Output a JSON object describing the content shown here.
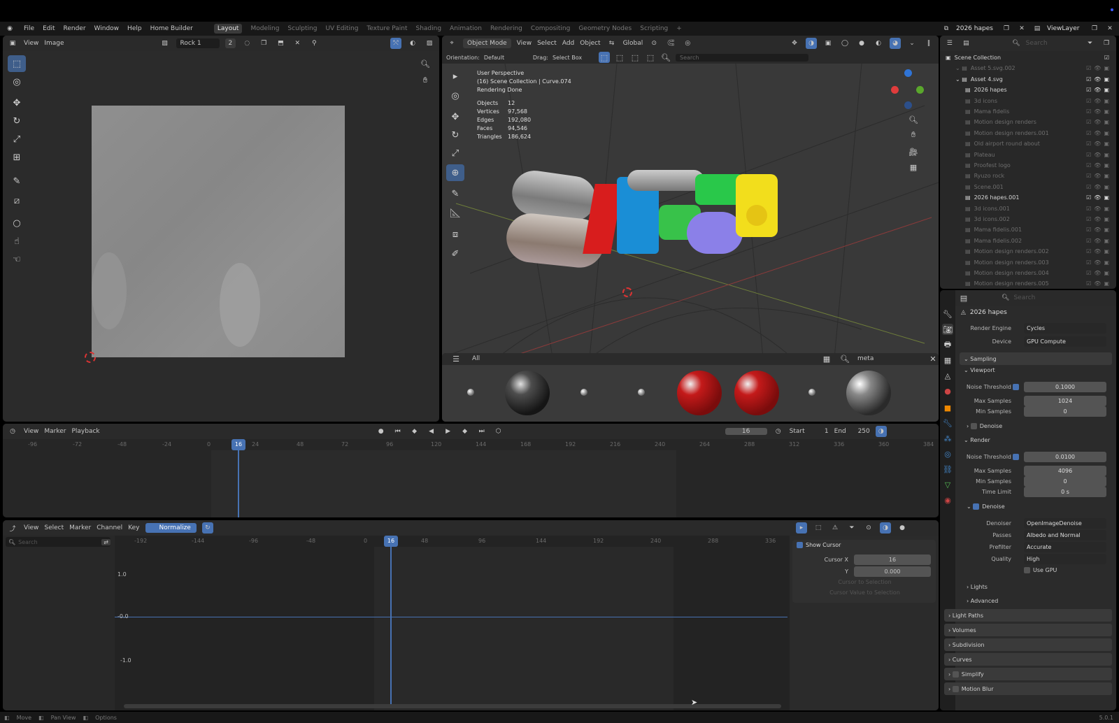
{
  "menubar": {
    "items": [
      "File",
      "Edit",
      "Render",
      "Window",
      "Help",
      "Home Builder"
    ],
    "workspaces": [
      "Layout",
      "Modeling",
      "Sculpting",
      "UV Editing",
      "Texture Paint",
      "Shading",
      "Animation",
      "Rendering",
      "Compositing",
      "Geometry Nodes",
      "Scripting"
    ],
    "add": "+",
    "scene": "2026 hapes",
    "viewlayer": "ViewLayer"
  },
  "image_editor": {
    "view": "View",
    "image": "Image",
    "image_name": "Rock 1",
    "users": "2"
  },
  "viewport": {
    "mode": "Object Mode",
    "menus": [
      "View",
      "Select",
      "Add",
      "Object"
    ],
    "transform": "Global",
    "orientation_label": "Orientation:",
    "orientation": "Default",
    "drag_label": "Drag:",
    "drag": "Select Box",
    "search_placeholder": "Search",
    "overlay": [
      "User Perspective",
      "(16) Scene Collection | Curve.074",
      "Rendering Done"
    ],
    "stats": [
      {
        "k": "Objects",
        "v": "12"
      },
      {
        "k": "Vertices",
        "v": "97,568"
      },
      {
        "k": "Edges",
        "v": "192,080"
      },
      {
        "k": "Faces",
        "v": "94,546"
      },
      {
        "k": "Triangles",
        "v": "186,624"
      }
    ]
  },
  "asset_browser": {
    "tab": "All",
    "search": "meta"
  },
  "timeline": {
    "menus": [
      "View",
      "Marker",
      "Playback"
    ],
    "frame": "16",
    "start_label": "Start",
    "start": "1",
    "end_label": "End",
    "end": "250",
    "ticks": [
      "-96",
      "-72",
      "-48",
      "-24",
      "0",
      "24",
      "48",
      "72",
      "96",
      "120",
      "144",
      "168",
      "192",
      "216",
      "240",
      "264",
      "288",
      "312",
      "336",
      "360",
      "384"
    ],
    "current": "16"
  },
  "graph": {
    "menus": [
      "View",
      "Select",
      "Marker",
      "Channel",
      "Key"
    ],
    "normalize": "Normalize",
    "search_placeholder": "Search",
    "ticks": [
      "-192",
      "-144",
      "-96",
      "-48",
      "0",
      "48",
      "96",
      "144",
      "192",
      "240",
      "288",
      "336"
    ],
    "current": "16",
    "ylabels": [
      "1.0",
      "-0.0",
      "-1.0"
    ],
    "cursor_panel": {
      "title": "Show Cursor",
      "x_label": "Cursor X",
      "x": "16",
      "y_label": "Y",
      "y": "0.000",
      "btn1": "Cursor to Selection",
      "btn2": "Cursor Value to Selection"
    }
  },
  "status": {
    "items": [
      "Move",
      "Pan View",
      "Options"
    ],
    "version": "5.0.1"
  },
  "outliner": {
    "rows": [
      {
        "t": "Scene Collection",
        "lvl": 0,
        "b": true
      },
      {
        "t": "Asset 5.svg.002",
        "lvl": 1,
        "b": false
      },
      {
        "t": "Asset 4.svg",
        "lvl": 1,
        "b": true
      },
      {
        "t": "2026 hapes",
        "lvl": 2,
        "b": true
      },
      {
        "t": "3d icons",
        "lvl": 2,
        "b": false
      },
      {
        "t": "Mama fidelis",
        "lvl": 2,
        "b": false
      },
      {
        "t": "Motion design renders",
        "lvl": 2,
        "b": false
      },
      {
        "t": "Motion design renders.001",
        "lvl": 2,
        "b": false
      },
      {
        "t": "Old airport round about",
        "lvl": 2,
        "b": false
      },
      {
        "t": "Plateau",
        "lvl": 2,
        "b": false
      },
      {
        "t": "Proofest logo",
        "lvl": 2,
        "b": false
      },
      {
        "t": "Ryuzo rock",
        "lvl": 2,
        "b": false
      },
      {
        "t": "Scene.001",
        "lvl": 2,
        "b": false
      },
      {
        "t": "2026 hapes.001",
        "lvl": 2,
        "b": true
      },
      {
        "t": "3d icons.001",
        "lvl": 2,
        "b": false
      },
      {
        "t": "3d icons.002",
        "lvl": 2,
        "b": false
      },
      {
        "t": "Mama fidelis.001",
        "lvl": 2,
        "b": false
      },
      {
        "t": "Mama fidelis.002",
        "lvl": 2,
        "b": false
      },
      {
        "t": "Motion design renders.002",
        "lvl": 2,
        "b": false
      },
      {
        "t": "Motion design renders.003",
        "lvl": 2,
        "b": false
      },
      {
        "t": "Motion design renders.004",
        "lvl": 2,
        "b": false
      },
      {
        "t": "Motion design renders.005",
        "lvl": 2,
        "b": false
      }
    ]
  },
  "properties": {
    "scene": "2026 hapes",
    "search": "Search",
    "render_engine_label": "Render Engine",
    "render_engine": "Cycles",
    "device_label": "Device",
    "device": "GPU Compute",
    "sampling": "Sampling",
    "viewport": "Viewport",
    "noise_label": "Noise Threshold",
    "vp_noise": "0.1000",
    "max_label": "Max Samples",
    "vp_max": "1024",
    "min_label": "Min Samples",
    "vp_min": "0",
    "denoise": "Denoise",
    "render": "Render",
    "r_noise": "0.0100",
    "r_max": "4096",
    "r_min": "0",
    "time_label": "Time Limit",
    "r_time": "0 s",
    "denoiser_label": "Denoiser",
    "denoiser": "OpenImageDenoise",
    "passes_label": "Passes",
    "passes": "Albedo and Normal",
    "prefilter_label": "Prefilter",
    "prefilter": "Accurate",
    "quality_label": "Quality",
    "quality": "High",
    "use_gpu": "Use GPU",
    "lights": "Lights",
    "advanced": "Advanced",
    "light_paths": "Light Paths",
    "volumes": "Volumes",
    "subdivision": "Subdivision",
    "curves": "Curves",
    "simplify": "Simplify",
    "motion_blur": "Motion Blur"
  },
  "colors": {
    "accent": "#4772b3",
    "bg": "#303030",
    "header": "#2a2a2a"
  }
}
